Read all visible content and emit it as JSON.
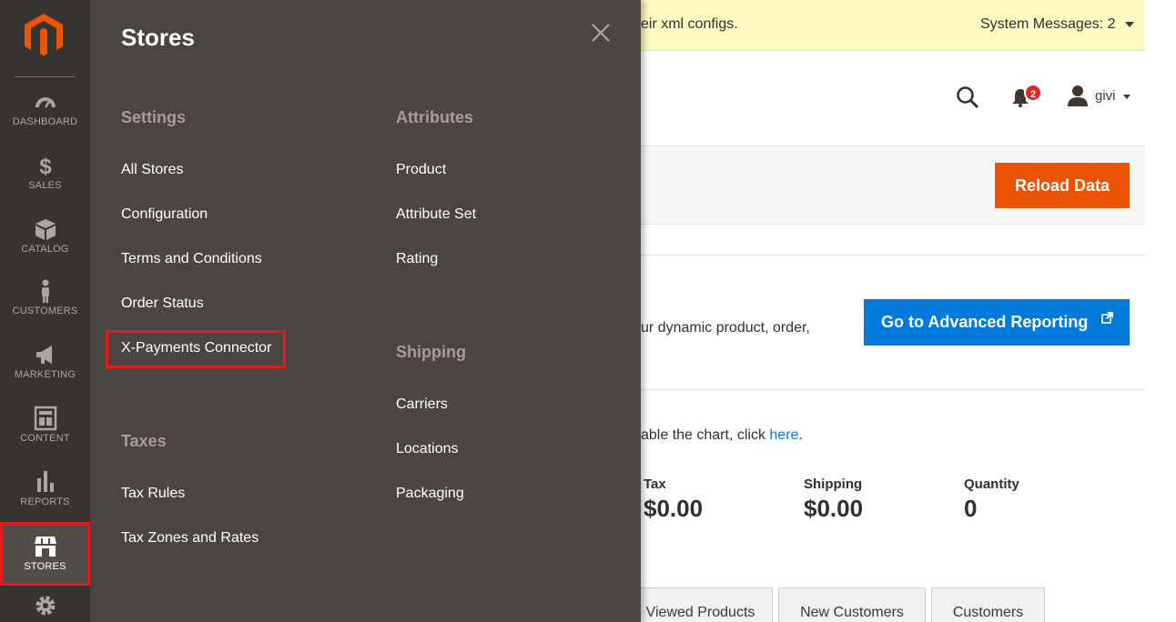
{
  "sidebar": {
    "logo": "magento-logo",
    "items": [
      {
        "label": "Dashboard",
        "icon": "dashboard-icon"
      },
      {
        "label": "Sales",
        "icon": "dollar-icon"
      },
      {
        "label": "Catalog",
        "icon": "box-icon"
      },
      {
        "label": "Customers",
        "icon": "person-icon"
      },
      {
        "label": "Marketing",
        "icon": "megaphone-icon"
      },
      {
        "label": "Content",
        "icon": "layout-icon"
      },
      {
        "label": "Reports",
        "icon": "bar-chart-icon"
      },
      {
        "label": "Stores",
        "icon": "storefront-icon",
        "active": true
      },
      {
        "label": "",
        "icon": "gear-icon"
      }
    ]
  },
  "submenu": {
    "title": "Stores",
    "groups": {
      "settings": {
        "title": "Settings",
        "items": [
          "All Stores",
          "Configuration",
          "Terms and Conditions",
          "Order Status",
          "X-Payments Connector"
        ]
      },
      "taxes": {
        "title": "Taxes",
        "items": [
          "Tax Rules",
          "Tax Zones and Rates"
        ]
      },
      "attributes": {
        "title": "Attributes",
        "items": [
          "Product",
          "Attribute Set",
          "Rating"
        ]
      },
      "shipping": {
        "title": "Shipping",
        "items": [
          "Carriers",
          "Locations",
          "Packaging"
        ]
      }
    }
  },
  "messages": {
    "text": "eir xml configs.",
    "system_label": "System Messages: 2"
  },
  "header": {
    "notifications_count": "2",
    "user_name": "givi"
  },
  "actions": {
    "reload_label": "Reload Data"
  },
  "advanced": {
    "text": "ur dynamic product, order,",
    "button_label": "Go to Advanced Reporting"
  },
  "chart_note": {
    "text": "able the chart, click ",
    "link": "here",
    "suffix": "."
  },
  "stats": [
    {
      "label": "Tax",
      "value": "$0.00"
    },
    {
      "label": "Shipping",
      "value": "$0.00"
    },
    {
      "label": "Quantity",
      "value": "0"
    }
  ],
  "tabs": [
    "Viewed Products",
    "New Customers",
    "Customers"
  ],
  "colors": {
    "sidebar_bg": "#373330",
    "submenu_bg": "#4a4542",
    "accent_orange": "#eb5202",
    "accent_blue": "#007bdb",
    "highlight_red": "#e51b1b"
  }
}
